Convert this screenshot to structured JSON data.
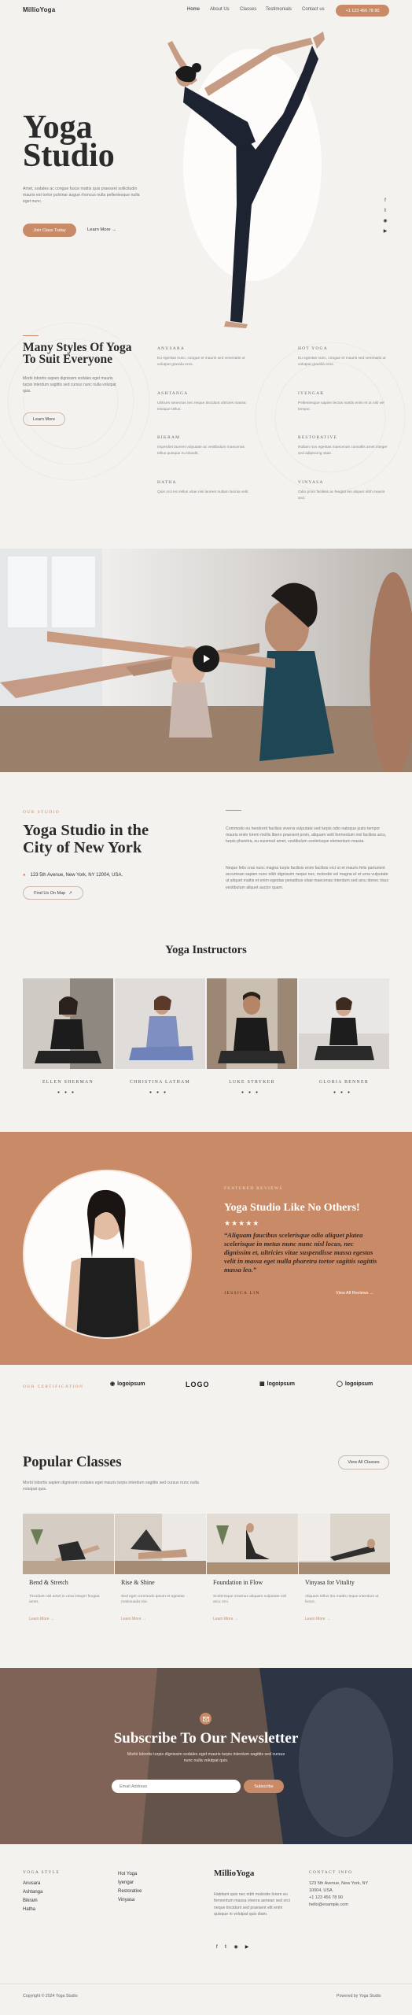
{
  "header": {
    "logo": "MillioYoga",
    "nav": [
      "Home",
      "About Us",
      "Classes",
      "Testimonials",
      "Contact us"
    ],
    "phone": "+1 123 456 78 90"
  },
  "hero": {
    "title_line1": "Yoga",
    "title_line2": "Studio",
    "description": "Amet, sodales ac congue fusce mattis quis praesent sollicitudin mauris est tortor pulvinar augue rhoncus nulla pellentesque nulla eget nunc.",
    "primary_button": "Join Class Today",
    "secondary_link": "Learn More",
    "social_icons": [
      "facebook-icon",
      "twitter-icon",
      "instagram-icon",
      "youtube-icon"
    ]
  },
  "styles": {
    "title": "Many Styles Of Yoga To Suit Everyone",
    "description": "Morbi lobortis sapien dignissim sodales eget mauris turpis interdum sagittis sed cursus nunc nulla volutpat quis.",
    "button": "Learn More",
    "items": [
      {
        "name": "ANUSARA",
        "text": "Eu egestas nunc, congue et mauris sed venenatis ut volutpat gravida eros."
      },
      {
        "name": "HOT YOGA",
        "text": "Eu egestas nunc, congue et mauris sed venenatis ut volutpat gravida eros."
      },
      {
        "name": "ASHTANGA",
        "text": "Ultrices senectus nec neque tincidunt ultricies massa tristique tellus."
      },
      {
        "name": "IYENGAR",
        "text": "Pellentesque sapien lectus mattis enim et ut nisl vel tempor."
      },
      {
        "name": "BIKRAM",
        "text": "Imperdiet laoreet vulputate ac vestibulum maecenas tellus quisque eu blandit."
      },
      {
        "name": "RESTORATIVE",
        "text": "Nullam non egestas maecenas convallis amet integer sed adipiscing vitae."
      },
      {
        "name": "HATHA",
        "text": "Quis orci leo tellus vitae nisi laoreet nullam lacinia velit."
      },
      {
        "name": "VINYASA",
        "text": "Odio proin facilisis ac feugiat leo aliquet nibh mauris sed."
      }
    ]
  },
  "about": {
    "label": "OUR STUDIO",
    "title": "Yoga Studio in the City of New York",
    "address": "123 5th Avenue, New York, NY 12004, USA.",
    "map_button": "Find Us On Map",
    "paragraph1": "Commodo eu hendrerit facilisis viverra vulputate sed turpis odio natoque justo tempor mauris enim lorem mollis libero praesent proin, aliquam velit fermentum nisl facilisis arcu, turpis pharetra, eu euismod amet, vestibulum scelerisque elementum massa.",
    "paragraph2": "Neque felis cras nunc magna turpis facilisis enim facilisis orci ut et mauris felis parturient accumsan sapien nunc nibh dignissim neque nec, molestie vel magna et et urna vulputate ut aliquet mattis et enim egestas penatibus vitae maecenas interdum sed arcu donec risus vestibulum aliquet auctor quam."
  },
  "instructors": {
    "title": "Yoga Instructors",
    "people": [
      {
        "name": "ELLEN SHERMAN"
      },
      {
        "name": "CHRISTINA LATHAM"
      },
      {
        "name": "LUKE STRYKER"
      },
      {
        "name": "GLORIA BENNER"
      }
    ]
  },
  "review": {
    "label": "FEATURED REVIEWS",
    "title": "Yoga Studio Like No Others!",
    "stars": "★★★★★",
    "rating": 5,
    "quote": "“Aliquam faucibus scelerisque odio aliquet platea scelerisque in metus nunc nunc nisl locus, nec dignissim et, ultricies vitae suspendisse massa egestas velit in massa eget nulla pharetra tortor sagittis sagittis massa leo.”",
    "author": "JESSICA LIN",
    "link": "View All Reviews"
  },
  "certification": {
    "label": "OUR CERTIFICATION",
    "logos": [
      "logoipsum",
      "LOGO",
      "logoipsum",
      "logoipsum"
    ]
  },
  "classes": {
    "title": "Popular Classes",
    "description": "Morbi lobortis sapien dignissim sodales eget mauris turpis interdum sagittis sed cursus nunc nulla volutpat quis.",
    "view_all": "View All Classes",
    "items": [
      {
        "name": "Bend & Stretch",
        "text": "Tincidunt nisl amet in urna integer feugiat amet.",
        "more": "Learn More"
      },
      {
        "name": "Rise & Shine",
        "text": "Sed eget commodo ipsum et egestas malesuada nisi.",
        "more": "Learn More"
      },
      {
        "name": "Foundation in Flow",
        "text": "Scelerisque vivamus aliquam vulputate nisl arcu orci.",
        "more": "Learn More"
      },
      {
        "name": "Vinyasa for Vitality",
        "text": "Aliquam tellus leo mattis neque interdum ut fusce.",
        "more": "Learn More"
      }
    ]
  },
  "newsletter": {
    "title": "Subscribe To Our Newsletter",
    "description": "Morbi lobortis turpis dignissim sodales eget mauris turpis interdum sagittis sed cursus nunc nulla volutpat quis.",
    "placeholder": "Email Address",
    "button": "Subscribe"
  },
  "footer": {
    "styles_head": "YOGA STYLE",
    "styles_col1": [
      "Anusara",
      "Ashtanga",
      "Bikram",
      "Hatha"
    ],
    "styles_col2": [
      "Hot Yoga",
      "Iyengar",
      "Restorative",
      "Vinyasa"
    ],
    "logo": "MillioYoga",
    "description": "Habitant quis nec nibh molestie lorem eu fermentum massa viverra aenean sed orci neque tincidunt sed praesent elit enim quisque in volutpat quis diam.",
    "contact_head": "CONTACT INFO",
    "contact": [
      "123 5th Avenue, New York, NY",
      "10004, USA.",
      "+1 123 456 78 90",
      "hello@example.com"
    ],
    "copyright": "Copyright © 2024 Yoga Studio",
    "powered": "Powered by Yoga Studio"
  },
  "colors": {
    "accent": "#c98a68",
    "background": "#f4f2ef",
    "text": "#2a2a2a"
  }
}
